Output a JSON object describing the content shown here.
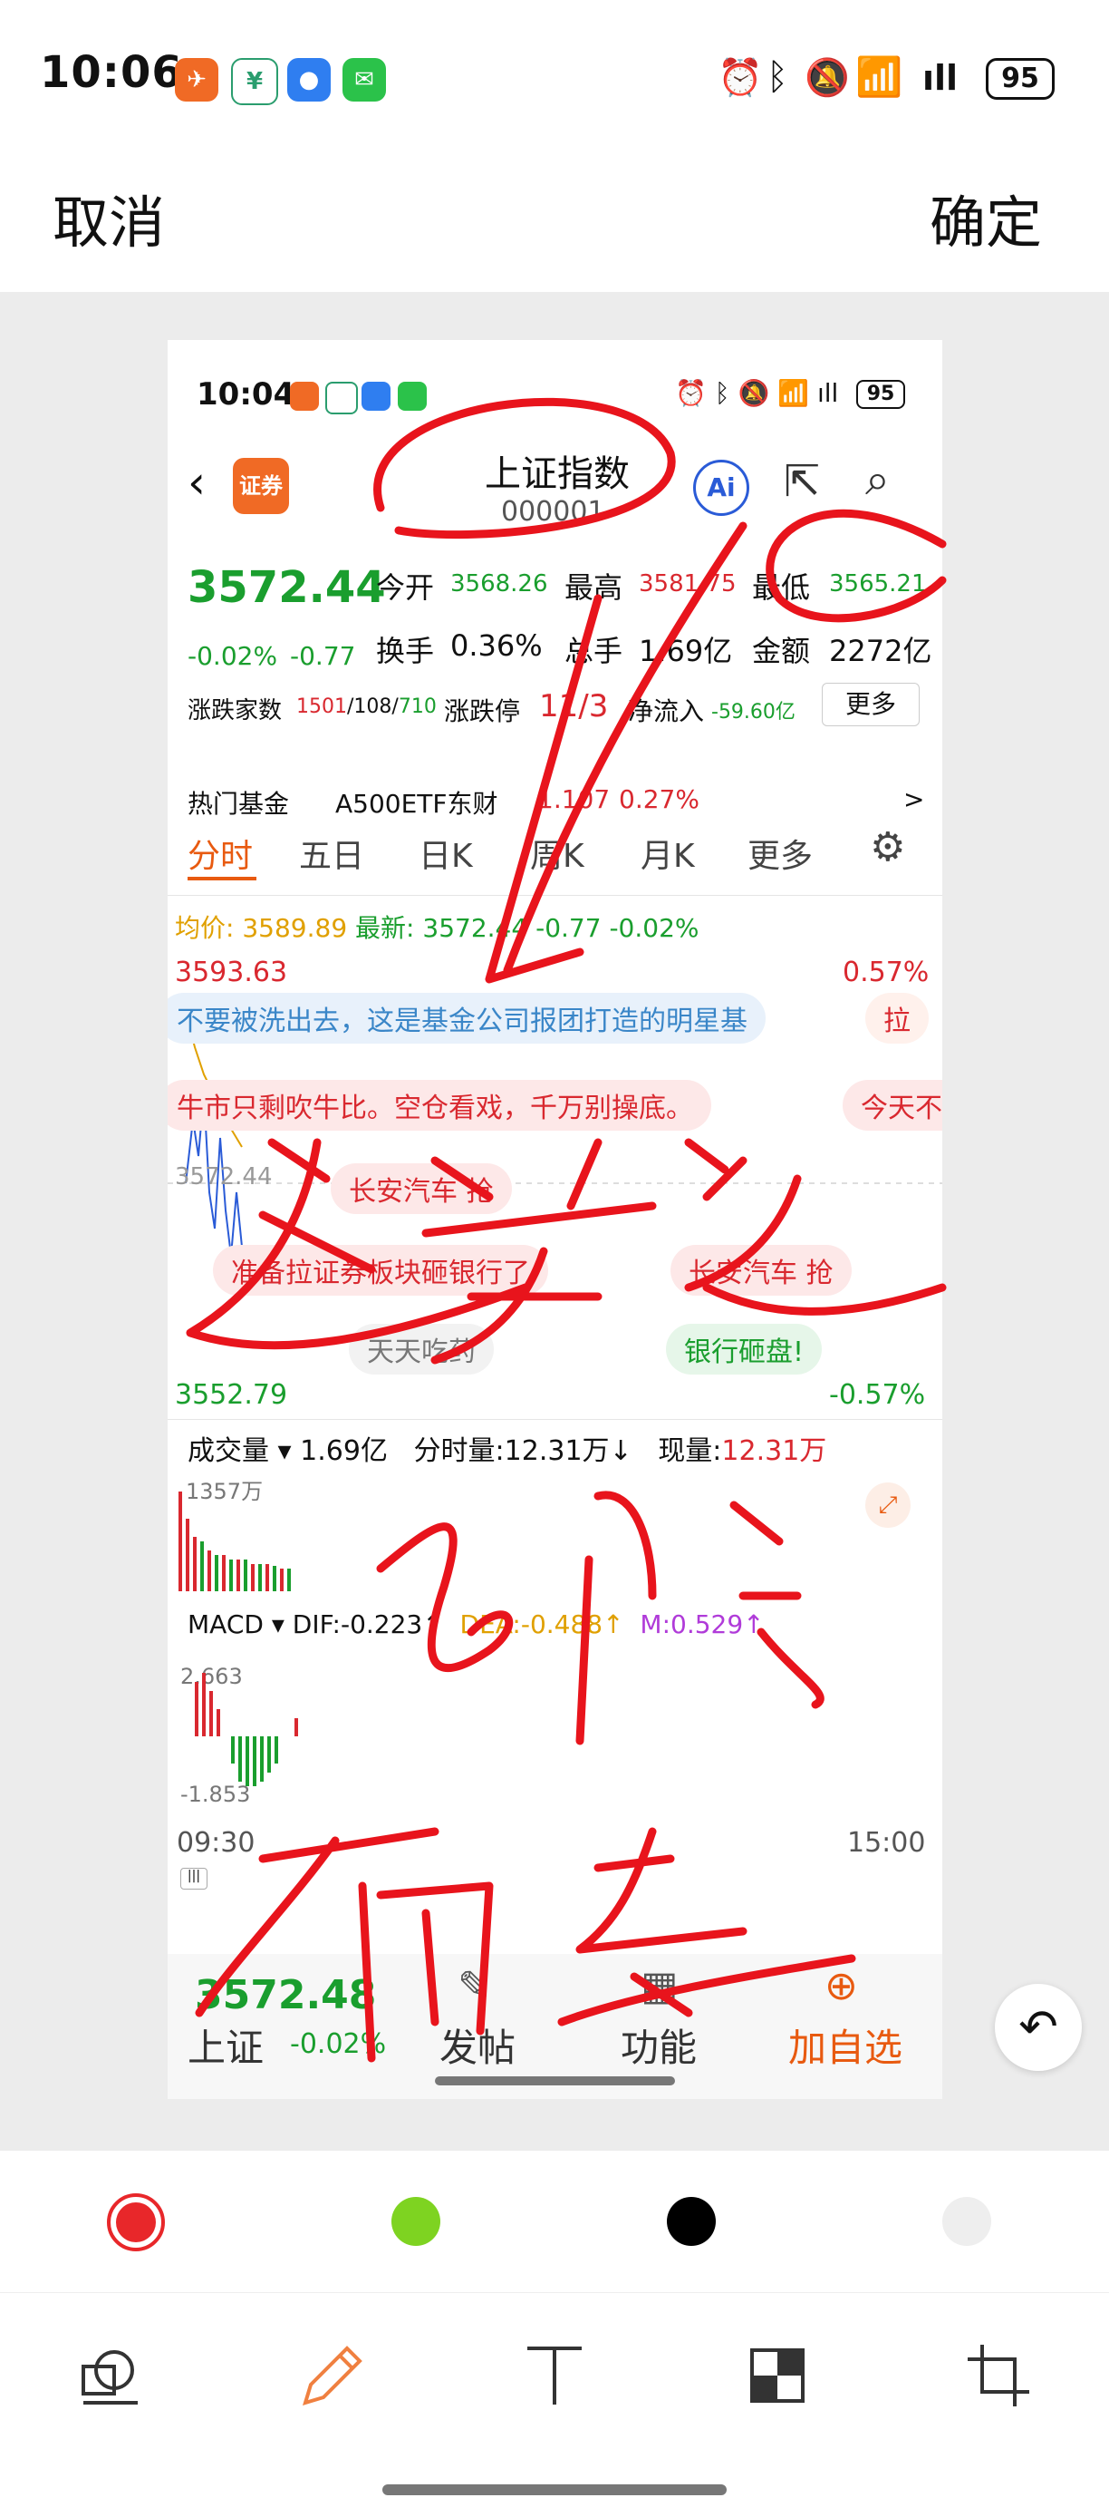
{
  "status_bar": {
    "time": "10:06",
    "battery": "95"
  },
  "header": {
    "cancel": "取消",
    "confirm": "确定"
  },
  "inner": {
    "status_time": "10:04",
    "battery": "95",
    "logo_text": "证券",
    "title": "上证指数",
    "code": "000001",
    "ai": "Ai",
    "price": "3572.44",
    "change_pct": "-0.02%",
    "change": "-0.77",
    "open_label": "今开",
    "open": "3568.26",
    "high_label": "最高",
    "high": "3581.75",
    "low_label": "最低",
    "low": "3565.21",
    "turnover_label": "换手",
    "turnover": "0.36%",
    "vol_label": "总手",
    "vol": "1.69亿",
    "amount_label": "金额",
    "amount": "2272亿",
    "updown_label": "涨跌家数",
    "up": "1501",
    "flat": "108",
    "down": "710",
    "limit_label": "涨跌停",
    "limit": "11/3",
    "inflow_label": "净流入",
    "inflow": "-59.60亿",
    "more": "更多",
    "hot_label": "热门基金",
    "hot_name": "A500ETF东财",
    "hot_price": "1.107",
    "hot_pct": "0.27%",
    "hot_arrow": ">",
    "tabs": [
      "分时",
      "五日",
      "日K",
      "周K",
      "月K",
      "更多"
    ],
    "avg_label": "均价:",
    "avg": "3589.89",
    "last_label": "最新:",
    "last": "3572.44",
    "last_chg": "-0.77",
    "last_pct": "-0.02%",
    "chart_high": "3593.63",
    "chart_high_pct": "0.57%",
    "chart_mid": "3572.44",
    "chart_low": "3552.79",
    "chart_low_pct": "-0.57%",
    "danmaku": [
      "不要被洗出去，这是基金公司报团打造的明星基",
      "牛市只剩吹牛比。空仓看戏，千万别操底。",
      "今天不在",
      "长安汽车 抢",
      "准备拉证券板块砸银行了",
      "长安汽车 抢",
      "天天吃药",
      "银行砸盘!",
      "拉"
    ],
    "vol_bar_label": "成交量",
    "vol_bar_total": "1.69亿",
    "tick_label": "分时量:",
    "tick": "12.31万↓",
    "now_label": "现量:",
    "now": "12.31万",
    "vol_max": "1357万",
    "macd_label": "MACD",
    "dif": "DIF:-0.223↑",
    "dea": "DEA:-0.488↑",
    "m": "M:0.529↑",
    "macd_high": "2.663",
    "macd_low": "-1.853",
    "time_start": "09:30",
    "time_end": "15:00",
    "bottom_name": "上证",
    "bottom_price": "3572.48",
    "bottom_pct": "-0.02%",
    "nav": [
      "发帖",
      "功能",
      "加自选"
    ]
  },
  "annotation": {
    "text": [
      "还差近",
      "20个点",
      "砸盘"
    ],
    "color": "#e8141c"
  },
  "palette": {
    "colors": [
      "#e8272a",
      "#7ed321",
      "#000000",
      "#eeeeee"
    ],
    "selected": 0
  },
  "tools": [
    "eraser-icon",
    "pen-icon",
    "text-icon",
    "mosaic-icon",
    "crop-icon"
  ]
}
